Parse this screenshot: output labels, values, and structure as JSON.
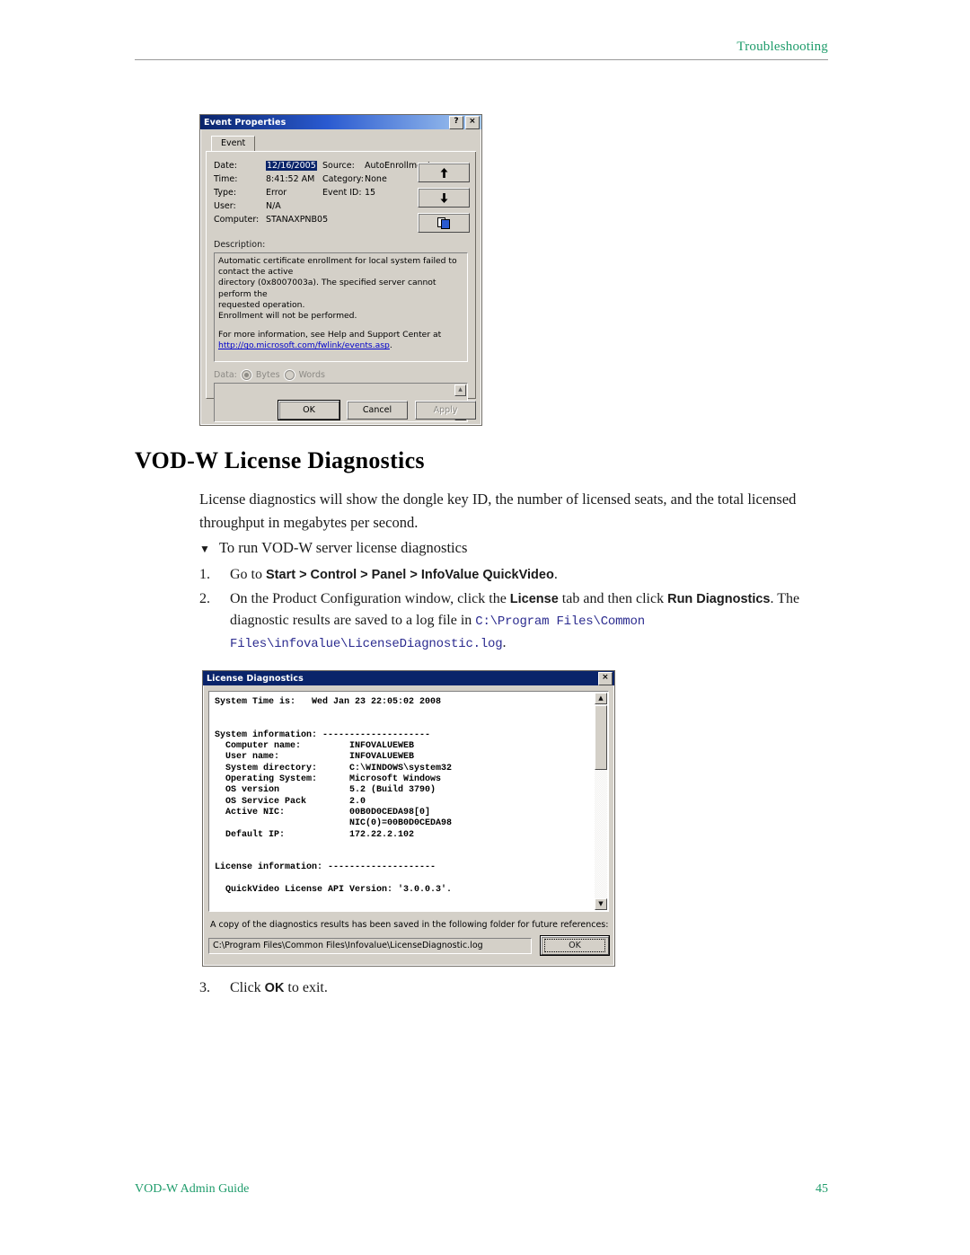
{
  "header": {
    "title": "Troubleshooting"
  },
  "footer": {
    "guide": "VOD-W Admin Guide",
    "page_number": "45"
  },
  "section": {
    "heading": "VOD-W License Diagnostics",
    "intro": "License diagnostics will show the dongle key ID, the number of licensed seats, and the total licensed throughput in megabytes per second.",
    "procedure_marker": "▼",
    "procedure_title": "To run VOD-W server license diagnostics",
    "steps": [
      {
        "number": "1.",
        "parts": [
          {
            "text": "Go to ",
            "style": "normal"
          },
          {
            "text": "Start > Control > Panel > InfoValue QuickVideo",
            "style": "bold"
          },
          {
            "text": ".",
            "style": "normal"
          }
        ]
      },
      {
        "number": "2.",
        "parts": [
          {
            "text": "On the Product Configuration window, click the ",
            "style": "normal"
          },
          {
            "text": "License",
            "style": "bold"
          },
          {
            "text": " tab and then click ",
            "style": "normal"
          },
          {
            "text": "Run Diagnostics",
            "style": "bold"
          },
          {
            "text": ". The diagnostic results are saved to a log file in ",
            "style": "normal"
          },
          {
            "text": "C:\\Program Files\\Common Files\\infovalue\\LicenseDiagnostic.log",
            "style": "mono"
          },
          {
            "text": ".",
            "style": "normal"
          }
        ]
      },
      {
        "number": "3.",
        "parts": [
          {
            "text": "Click ",
            "style": "normal"
          },
          {
            "text": "OK",
            "style": "bold"
          },
          {
            "text": " to exit.",
            "style": "normal"
          }
        ]
      }
    ]
  },
  "event_properties": {
    "title": "Event Properties",
    "titlebar_buttons": [
      {
        "icon": "help-icon",
        "label": "?"
      },
      {
        "icon": "close-icon",
        "label": "×"
      }
    ],
    "tab": "Event",
    "fields": {
      "date_label": "Date:",
      "date_value": "12/16/2005",
      "source_label": "Source:",
      "source_value": "AutoEnrollment",
      "time_label": "Time:",
      "time_value": "8:41:52 AM",
      "category_label": "Category:",
      "category_value": "None",
      "type_label": "Type:",
      "type_value": "Error",
      "eventid_label": "Event ID:",
      "eventid_value": "15",
      "user_label": "User:",
      "user_value": "N/A",
      "computer_label": "Computer:",
      "computer_value": "STANAXPNB05"
    },
    "nav_buttons": [
      {
        "name": "previous-event-button",
        "glyph": "↑"
      },
      {
        "name": "next-event-button",
        "glyph": "↓"
      },
      {
        "name": "copy-button",
        "glyph": "⧉"
      }
    ],
    "description_label": "Description:",
    "description_line1": "Automatic certificate enrollment for local system failed to contact the active",
    "description_line2": "directory (0x8007003a).  The specified server cannot perform the",
    "description_line3": "requested operation.",
    "description_line4": "  Enrollment will not be performed.",
    "description_line5": "For more information, see Help and Support Center at",
    "description_link": "http://go.microsoft.com/fwlink/events.asp",
    "description_link_tail": ".",
    "data_label": "Data:",
    "data_option_bytes": "Bytes",
    "data_option_words": "Words",
    "data_selected": "Bytes",
    "buttons": {
      "ok": "OK",
      "cancel": "Cancel",
      "apply": "Apply"
    }
  },
  "license_diagnostics": {
    "title": "License Diagnostics",
    "close_label": "×",
    "console_text": "System Time is:   Wed Jan 23 22:05:02 2008\n\n\nSystem information: --------------------\n  Computer name:         INFOVALUEWEB\n  User name:             INFOVALUEWEB\n  System directory:      C:\\WINDOWS\\system32\n  Operating System:      Microsoft Windows\n  OS version             5.2 (Build 3790)\n  OS Service Pack        2.0\n  Active NIC:            00B0D0CEDA98[0]\n                         NIC(0)=00B0D0CEDA98\n  Default IP:            172.22.2.102\n\n\nLicense information: --------------------\n\n  QuickVideo License API Version: '3.0.0.3'.",
    "note": "A copy of the diagnostics results has been saved in the following folder for future references:",
    "log_path": "C:\\Program Files\\Common Files\\Infovalue\\LicenseDiagnostic.log",
    "ok_label": "OK",
    "scroll_up": "▲",
    "scroll_down": "▼"
  },
  "colors": {
    "accent_green": "#1f9c6b",
    "titlebar_blue": "#0a246a",
    "dialog_face": "#d4d0c8",
    "mono_blue": "#2b2b8f",
    "link_blue": "#0000cc"
  }
}
